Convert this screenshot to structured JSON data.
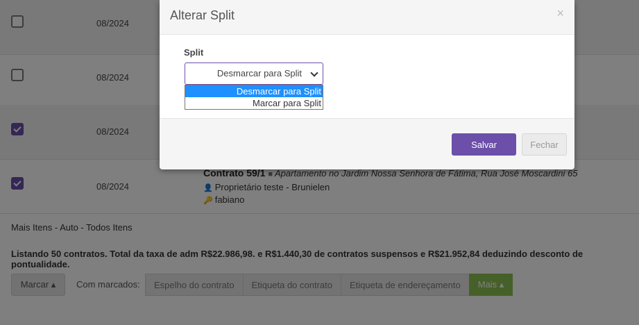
{
  "rows": [
    {
      "checked": false,
      "date": "08/2024"
    },
    {
      "checked": false,
      "date": "08/2024"
    },
    {
      "checked": true,
      "date": "08/2024"
    },
    {
      "checked": true,
      "date": "08/2024",
      "contract_title": "Contrato 59/1",
      "contract_address": "Apartamento no Jardim Nossa Senhora de Fátima, Rua José Moscardini 65",
      "owner": "Proprietário teste - Brunielen",
      "key_holder": "fabiano"
    }
  ],
  "footer": {
    "more_items": "Mais Itens - Auto - Todos Itens",
    "listing_summary": "Listando 50 contratos. Total da taxa de adm R$22.986,98. e R$1.440,30 de contratos suspensos e R$21.952,84 deduzindo desconto de pontualidade.",
    "mark_button": "Marcar ▴",
    "with_marked_label": "Com marcados:",
    "group_buttons": [
      "Espelho do contrato",
      "Etiqueta do contrato",
      "Etiqueta de endereçamento",
      "Mais ▴"
    ]
  },
  "modal": {
    "title": "Alterar Split",
    "close_glyph": "×",
    "field_label": "Split",
    "select_value": "Desmarcar para Split",
    "options": [
      "Desmarcar para Split",
      "Marcar para Split"
    ],
    "save_label": "Salvar",
    "close_label": "Fechar"
  },
  "colors": {
    "primary": "#6b4fa8",
    "success": "#8cc152",
    "dropdown_highlight": "#1e90ff"
  },
  "icons": {
    "person": "person-icon",
    "key": "key-icon",
    "chevron": "chevron-down-icon"
  }
}
